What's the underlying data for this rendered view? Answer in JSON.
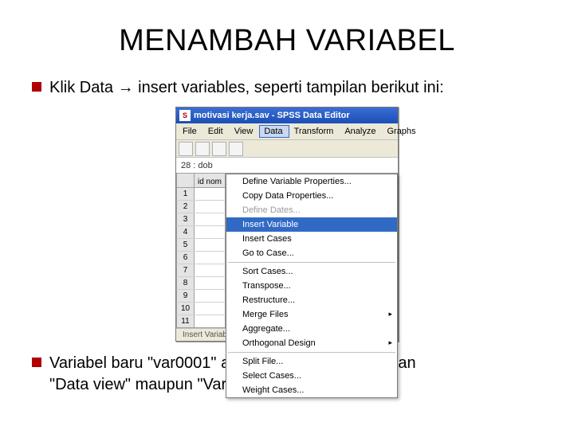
{
  "title": "MENAMBAH VARIABEL",
  "bullet1_prefix": "Klik Data ",
  "bullet1_arrow": "→",
  "bullet1_rest": " insert variables, seperti tampilan berikut ini:",
  "bullet2a": "Variabel baru \"var0001\" akan muncul pada tampilan",
  "bullet2b": "\"Data view\" maupun \"Variable View\"",
  "spss": {
    "window_title": "motivasi kerja.sav - SPSS Data Editor",
    "app_icon_label": "S",
    "menubar": [
      "File",
      "Edit",
      "View",
      "Data",
      "Transform",
      "Analyze",
      "Graphs"
    ],
    "open_menu_index": 3,
    "cell_indicator": "28 : dob",
    "colheader": "id nom",
    "row_numbers": [
      "1",
      "2",
      "3",
      "4",
      "5",
      "6",
      "7",
      "8",
      "9",
      "10",
      "11"
    ],
    "dropdown": [
      {
        "type": "item",
        "label": "Define Variable Properties..."
      },
      {
        "type": "item",
        "label": "Copy Data Properties..."
      },
      {
        "type": "item",
        "label": "Define Dates...",
        "dis": true
      },
      {
        "type": "item",
        "label": "Insert Variable",
        "highlight": true
      },
      {
        "type": "item",
        "label": "Insert Cases"
      },
      {
        "type": "item",
        "label": "Go to Case..."
      },
      {
        "type": "sep"
      },
      {
        "type": "item",
        "label": "Sort Cases..."
      },
      {
        "type": "item",
        "label": "Transpose..."
      },
      {
        "type": "item",
        "label": "Restructure..."
      },
      {
        "type": "item",
        "label": "Merge Files",
        "sub": true
      },
      {
        "type": "item",
        "label": "Aggregate..."
      },
      {
        "type": "item",
        "label": "Orthogonal Design",
        "sub": true
      },
      {
        "type": "sep"
      },
      {
        "type": "item",
        "label": "Split File..."
      },
      {
        "type": "item",
        "label": "Select Cases..."
      },
      {
        "type": "item",
        "label": "Weight Cases..."
      }
    ],
    "footer_tabs": [
      "Insert Variable"
    ]
  }
}
